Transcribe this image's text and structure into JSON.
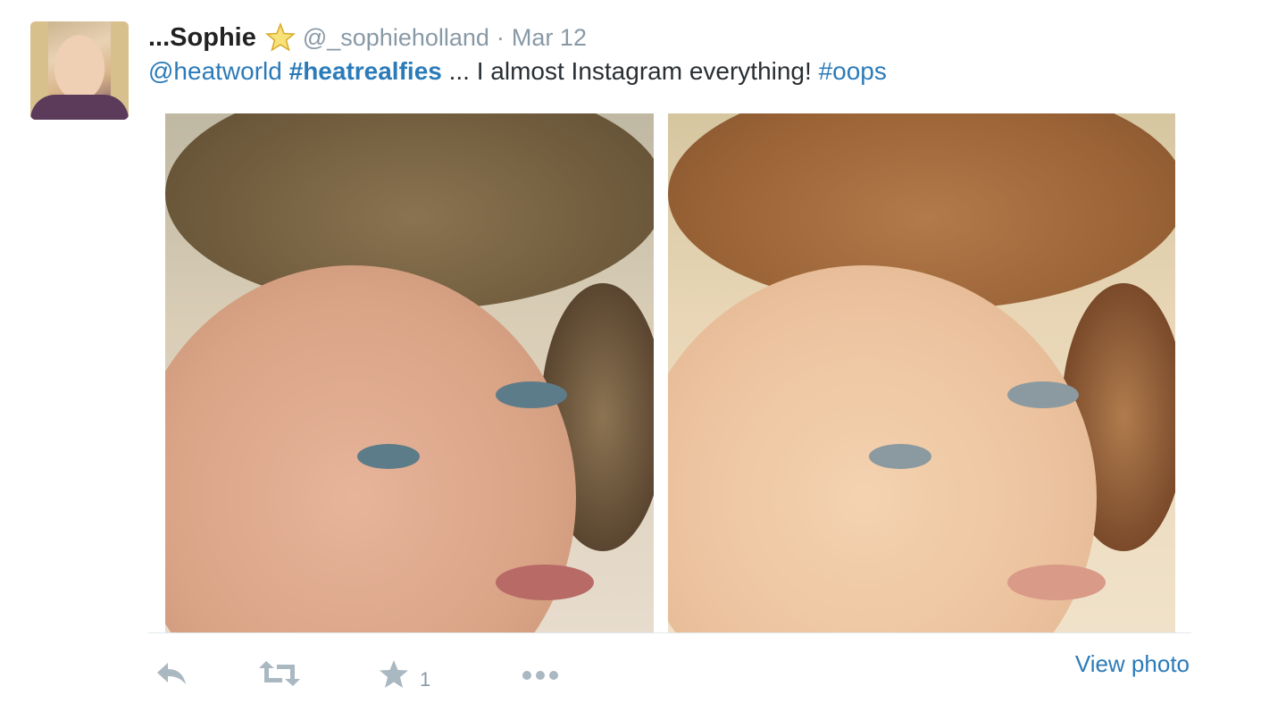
{
  "tweet": {
    "name": "...Sophie",
    "handle": "@_sophieholland",
    "separator": "·",
    "date": "Mar 12",
    "text_parts": {
      "mention": "@heatworld",
      "hashtag1": "#heatrealfies",
      "middle": " ... I almost Instagram everything! ",
      "hashtag2": "#oops"
    }
  },
  "actions": {
    "reply_icon": "reply-icon",
    "retweet_icon": "retweet-icon",
    "favorite_icon": "star-icon",
    "favorite_count": "1",
    "more_icon": "more-icon",
    "view_photo": "View photo"
  },
  "colors": {
    "link": "#2b7bb9",
    "muted": "#8899a6",
    "icon": "#aab8c2"
  }
}
